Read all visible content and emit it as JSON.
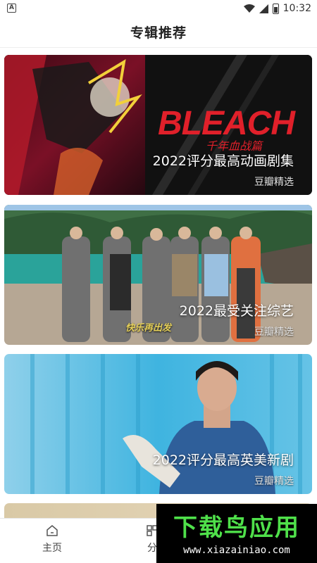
{
  "status_bar": {
    "left_icon": "A",
    "time": "10:32",
    "icons": [
      "wifi-icon",
      "signal-icon",
      "battery-icon"
    ]
  },
  "header": {
    "title": "专辑推荐"
  },
  "cards": [
    {
      "title": "2022评分最高动画剧集",
      "subtitle": "豆瓣精选",
      "art_text": "BLEACH",
      "art_subtext": "千年血战篇"
    },
    {
      "title": "2022最受关注综艺",
      "subtitle": "豆瓣精选",
      "art_text": "快乐再出发"
    },
    {
      "title": "2022评分最高英美新剧",
      "subtitle": "豆瓣精选"
    },
    {
      "title": "",
      "subtitle": ""
    }
  ],
  "bottom_nav": [
    {
      "label": "主页",
      "icon": "home-icon"
    },
    {
      "label": "分",
      "icon": "category-icon"
    }
  ],
  "watermark": {
    "logo": "下载鸟应用",
    "url": "www.xiazainiao.com"
  },
  "colors": {
    "accent": "#4fe04a",
    "bleach_red": "#e0202a"
  }
}
